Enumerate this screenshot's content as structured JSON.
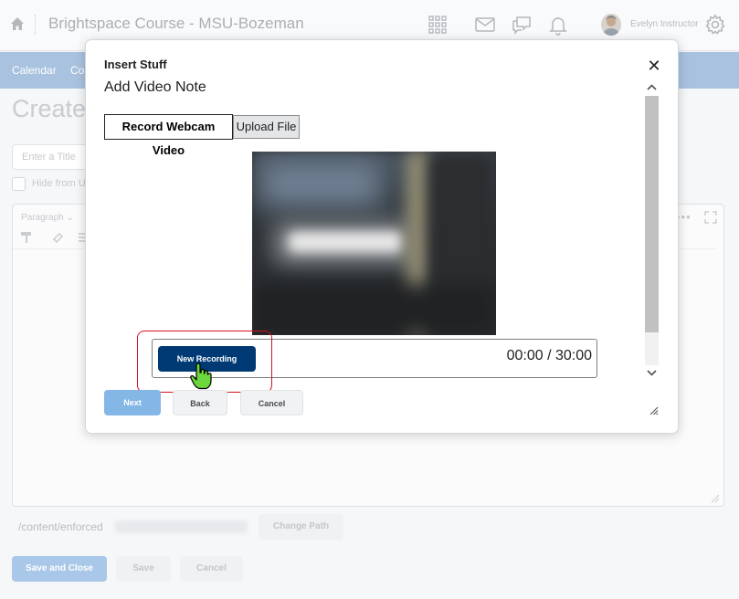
{
  "header": {
    "org_title": "Brightspace Course - MSU-Bozeman",
    "user_name": "Evelyn Instructor"
  },
  "nav": {
    "items": [
      "Calendar",
      "Co"
    ]
  },
  "background_page": {
    "heading": "Create",
    "title_placeholder": "Enter a Title",
    "hide_label": "Hide from U",
    "format_label": "Paragraph",
    "path_prefix": "/content/enforced",
    "change_path_label": "Change Path",
    "save_close_label": "Save and Close",
    "save_label": "Save",
    "cancel_label": "Cancel"
  },
  "dialog": {
    "title": "Insert Stuff",
    "subtitle": "Add Video Note",
    "tabs": [
      {
        "label": "Record Webcam Video",
        "selected": true
      },
      {
        "label": "Upload File",
        "selected": false
      }
    ],
    "recorder": {
      "new_recording_label": "New Recording",
      "timer": "00:00 / 30:00"
    },
    "buttons": {
      "next": "Next",
      "back": "Back",
      "cancel": "Cancel"
    }
  },
  "colors": {
    "primary": "#003a75",
    "highlight": "#d6101c",
    "nav_bar": "#a9c2df"
  }
}
